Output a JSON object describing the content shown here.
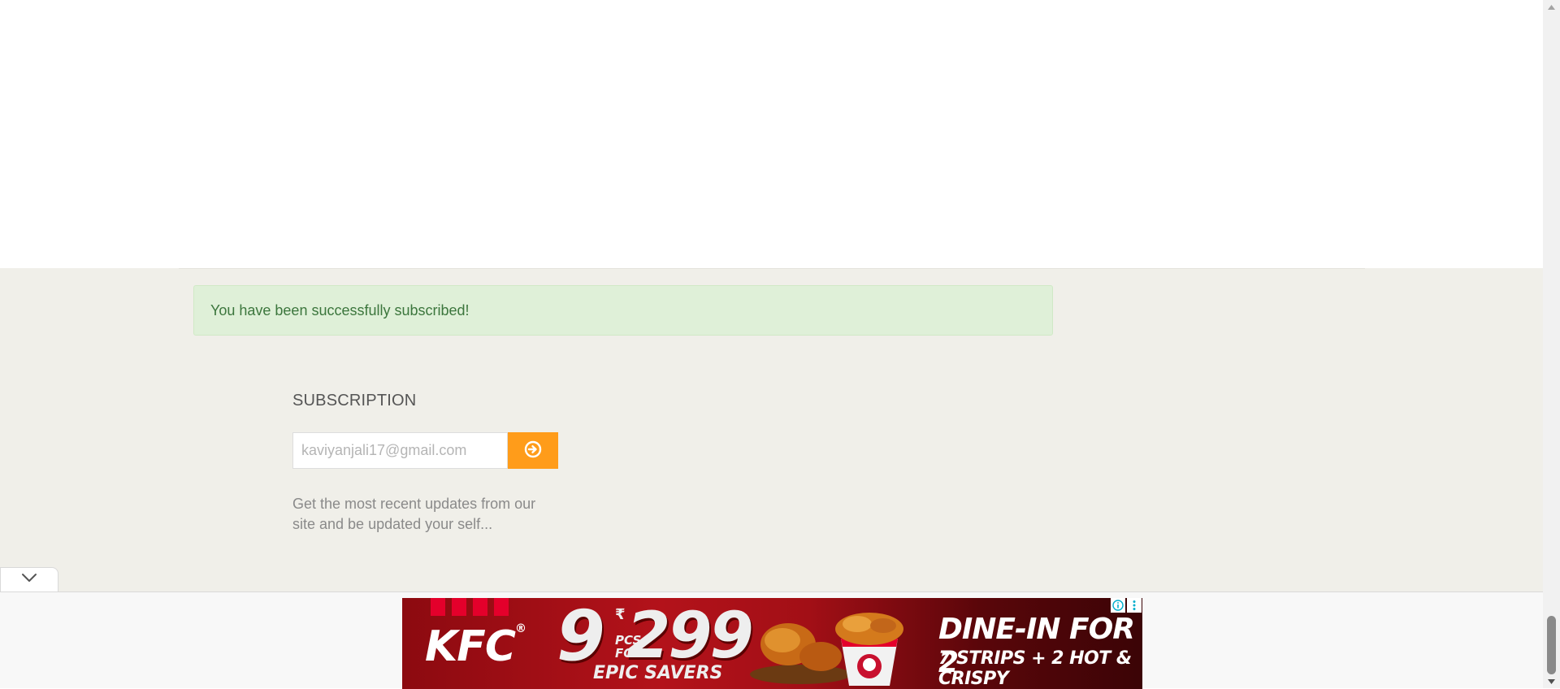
{
  "alert": {
    "message": "You have been successfully subscribed!",
    "color": "#3c763d",
    "background": "#dff0d8"
  },
  "subscription": {
    "title": "SUBSCRIPTION",
    "email_value": "",
    "email_placeholder": "kaviyanjali17@gmail.com",
    "submit_icon": "arrow-circle-right-icon",
    "button_color": "#ff9c1a",
    "description": "Get the most recent updates from our site and be updated your self..."
  },
  "collapse_toggle": {
    "icon": "chevron-down-icon"
  },
  "ad": {
    "brand": "KFC",
    "brand_mark": "®",
    "quantity": "9",
    "pcs_label": "PCS",
    "for_label": "FOR",
    "currency": "₹",
    "price": "299",
    "tagline": "EPIC SAVERS",
    "headline": "DINE-IN FOR 2",
    "subheadline": "7 STRIPS + 2 HOT & CRISPY",
    "info_icon": "info-icon",
    "menu_icon": "kebab-menu-icon"
  },
  "colors": {
    "footer_background": "#f0efe9",
    "ad_red": "#b3121a"
  }
}
